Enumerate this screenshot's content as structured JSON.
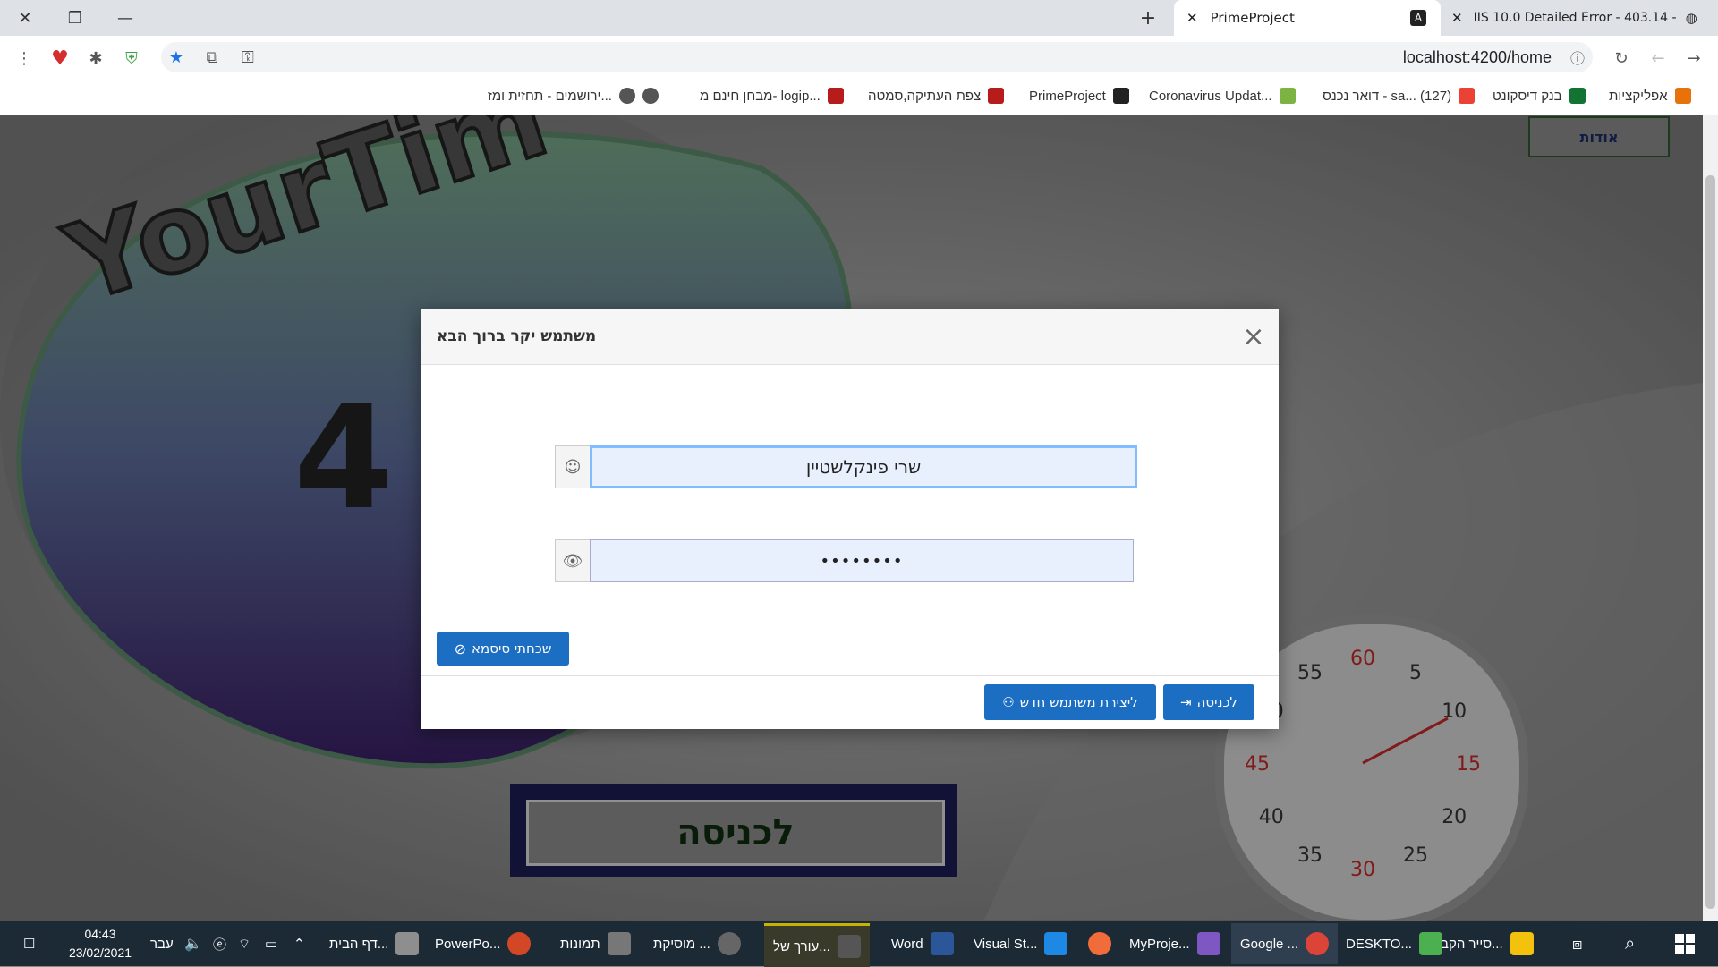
{
  "browser": {
    "tabs": [
      {
        "title": "PrimeProject",
        "active": true
      },
      {
        "title": "IIS 10.0 Detailed Error - 403.14 -",
        "active": false
      }
    ],
    "url": "localhost:4200/home",
    "bookmarks": [
      {
        "label": "אפליקציות",
        "color": "#e8710a"
      },
      {
        "label": "בנק דיסקונט",
        "color": "#137333"
      },
      {
        "label": "דואר נכנס - sa... (127)",
        "color": "#ea4335"
      },
      {
        "label": "Coronavirus Updat...",
        "color": "#7cb342"
      },
      {
        "label": "PrimeProject",
        "color": "#222222"
      },
      {
        "label": "צפת העתיקה,סמטה",
        "color": "#b71c1c"
      },
      {
        "label": "מבחן חינם מ- logip...",
        "color": "#b71c1c"
      },
      {
        "label": "ירושמים - תחזית ומז...",
        "color": "#555555"
      }
    ]
  },
  "page": {
    "about_button": "אודות",
    "logo_text": "YourTim",
    "logo_number": "4",
    "enter_banner": "לכניסה",
    "clock_numbers": [
      "60",
      "5",
      "10",
      "15",
      "20",
      "25",
      "30",
      "35",
      "40",
      "45",
      "50",
      "55"
    ]
  },
  "dialog": {
    "title": "משתמש יקר ברוך הבא",
    "username_value": "שרי פינקלשטיין",
    "password_value": "••••••••",
    "forgot_password": "שכחתי סיסמא",
    "create_user": "ליצירת משתמש חדש",
    "login": "לכניסה"
  },
  "taskbar": {
    "items": [
      {
        "label": "סייר הקב...",
        "color": "#f4c20d"
      },
      {
        "label": "DESKTO...",
        "color": "#4caf50"
      },
      {
        "label": "Google ...",
        "color": "#db4437"
      },
      {
        "label": "MyProje...",
        "color": "#7e57c2"
      },
      {
        "label": "",
        "color": "#f26b3a"
      },
      {
        "label": "Visual St...",
        "color": "#1e88e5"
      },
      {
        "label": "Word",
        "color": "#2b579a"
      },
      {
        "label": "עורך של...",
        "color": "#555555"
      },
      {
        "label": "מוסיקת ...",
        "color": "#666666"
      },
      {
        "label": "תמונות",
        "color": "#777777"
      },
      {
        "label": "PowerPo...",
        "color": "#d24726"
      },
      {
        "label": "דף הבית...",
        "color": "#8e8e8e"
      }
    ],
    "language": "עבר",
    "time": "04:43",
    "date": "23/02/2021"
  }
}
